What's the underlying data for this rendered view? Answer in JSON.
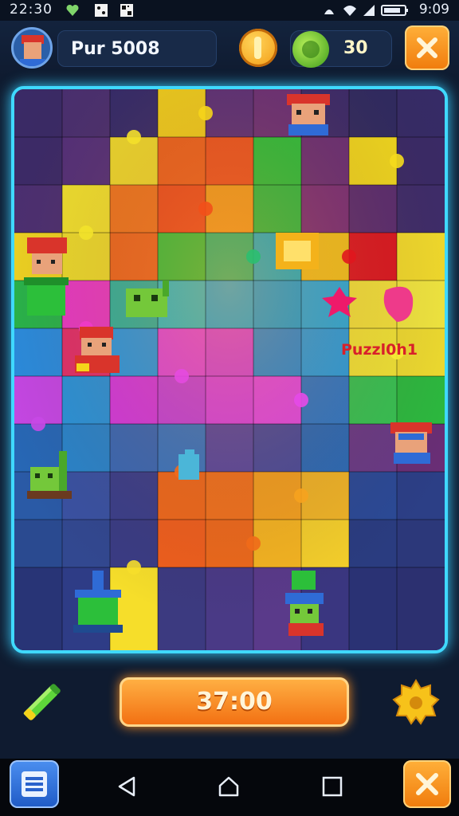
{
  "status_bar": {
    "time_left": "22:30",
    "time_right": "9:09",
    "icons": [
      "heart-icon",
      "dice-icon",
      "qr-icon",
      "notification-icon",
      "wifi-icon",
      "signal-icon",
      "battery-icon"
    ]
  },
  "header": {
    "player_name": "Pur 5008",
    "coin_icon": "coin-icon",
    "gem_count": "30",
    "gem_icon": "gem-icon",
    "close_icon": "close-icon"
  },
  "board": {
    "label": "Puzzl0h1",
    "border_color": "#3fd9ff"
  },
  "controls": {
    "timer": "37:00",
    "pencil_icon": "pencil-icon",
    "settings_icon": "gear-icon"
  },
  "nav_bar": {
    "menu_icon": "menu-icon",
    "back_icon": "back-icon",
    "home_icon": "home-icon",
    "recents_icon": "recents-icon",
    "close_icon": "close-icon"
  },
  "colors": {
    "accent_orange": "#f48a16",
    "neon_blue": "#3fd9ff",
    "background": "#0f1b30"
  }
}
